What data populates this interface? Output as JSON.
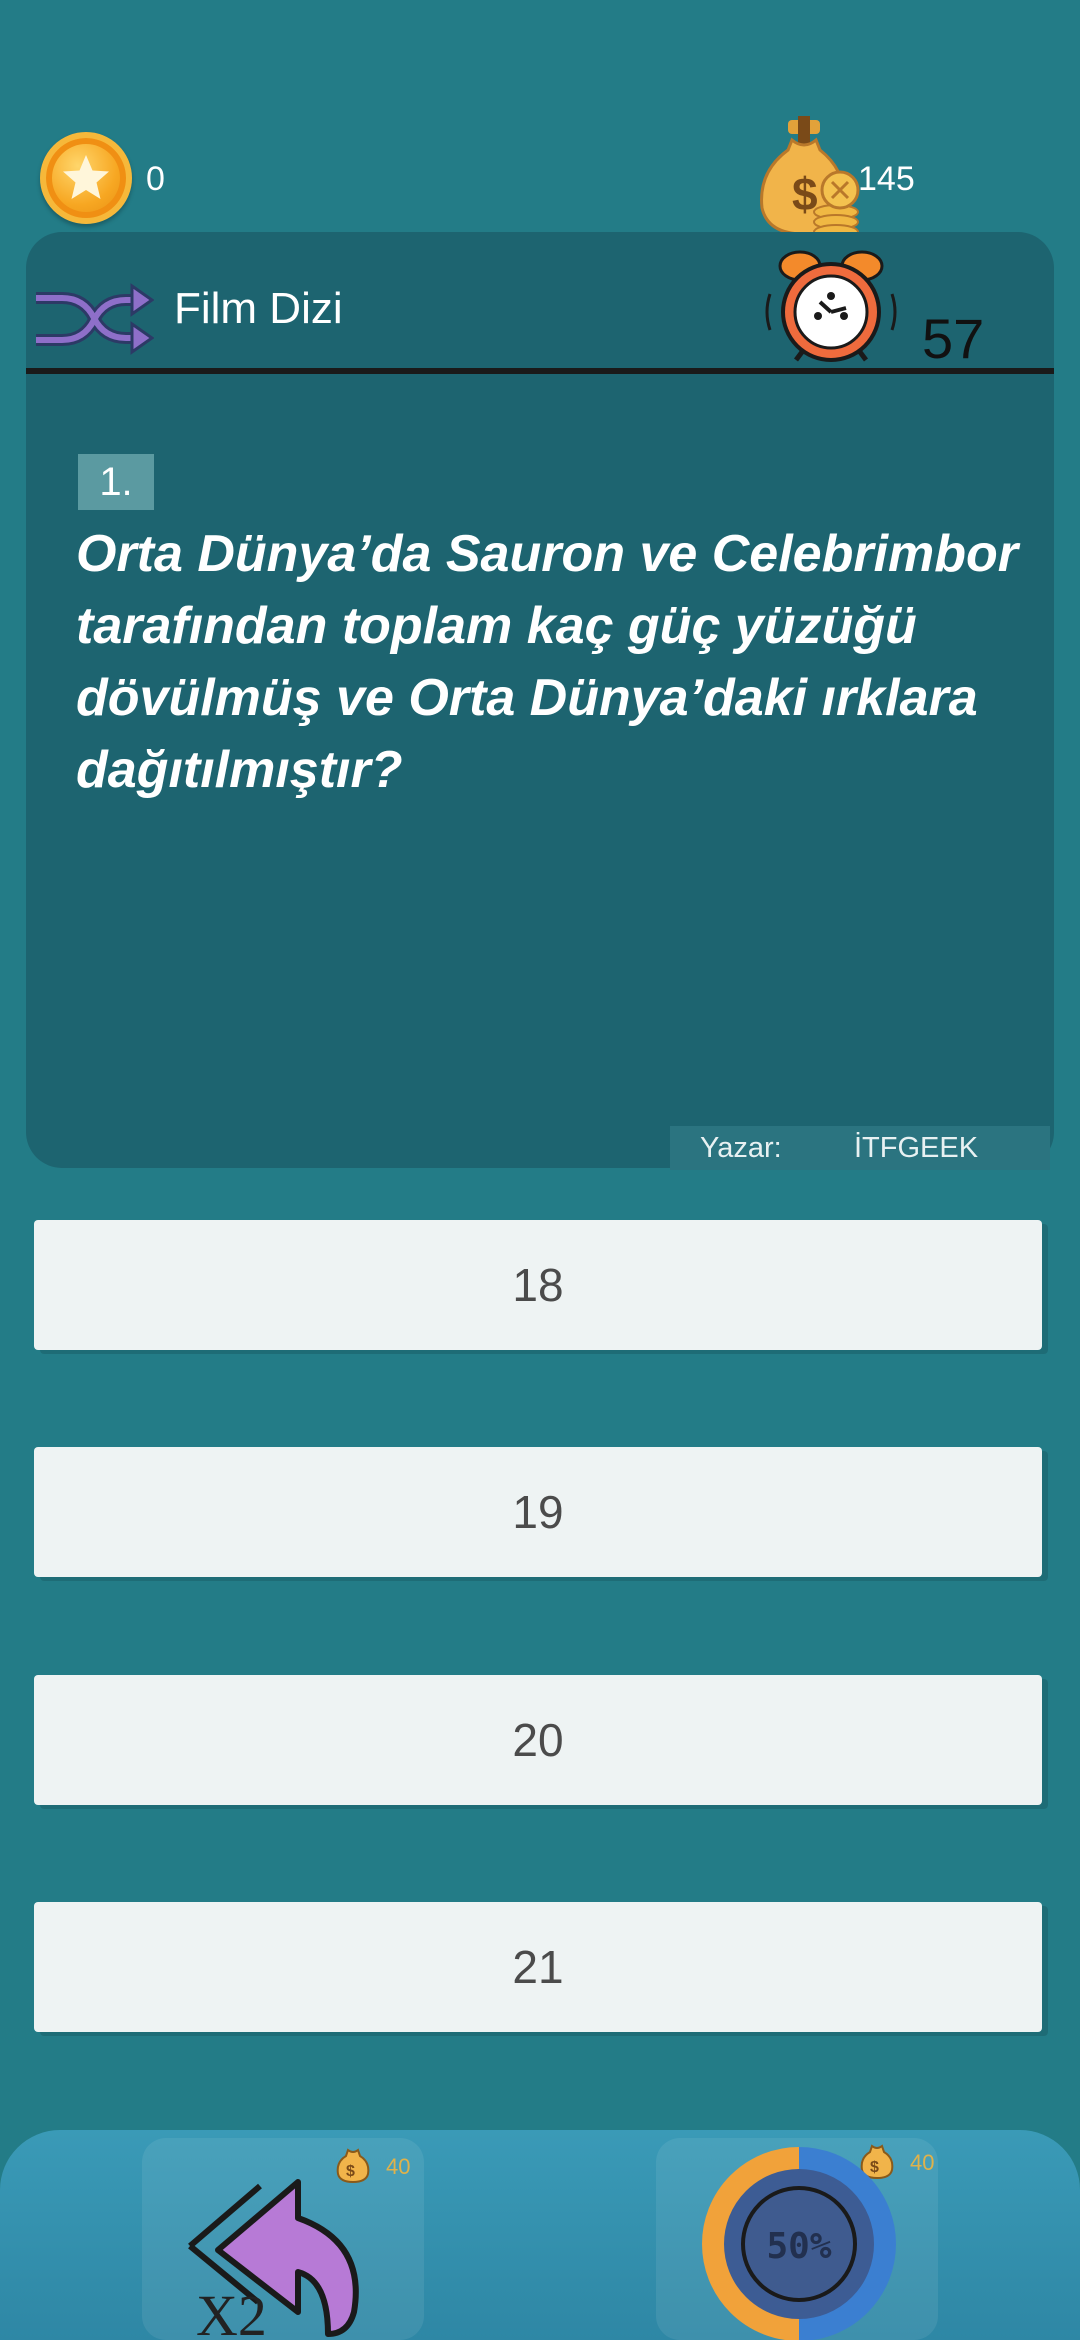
{
  "header": {
    "score": "0",
    "money": "145",
    "category": "Film Dizi",
    "timer": "57"
  },
  "question": {
    "number": "1.",
    "text": "Orta Dünya’da Sauron ve Celebrimbor tarafından toplam kaç güç yüzüğü dövülmüş ve Orta Dünya’daki ırklara dağıtılmıştır?",
    "author_label": "Yazar:",
    "author_name": "İTFGEEK"
  },
  "answers": [
    {
      "label": "18"
    },
    {
      "label": "19"
    },
    {
      "label": "20"
    },
    {
      "label": "21"
    }
  ],
  "jokers": {
    "double": {
      "label": "X2",
      "cost": "40"
    },
    "fifty": {
      "label": "50%",
      "cost": "40"
    }
  },
  "colors": {
    "background": "#237c87",
    "card": "#1d6470",
    "answer_bg": "#eef3f3",
    "coin": "#f7a722"
  }
}
